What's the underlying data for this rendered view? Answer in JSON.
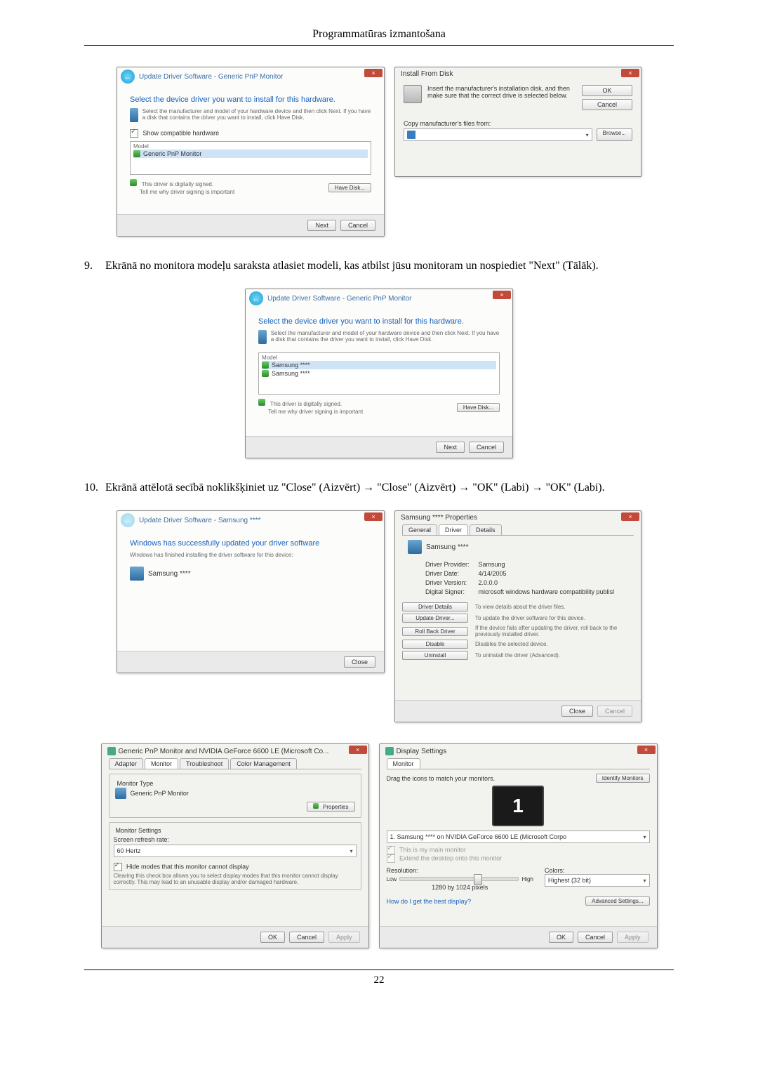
{
  "header": "Programmatūras izmantošana",
  "page_number": "22",
  "step9": {
    "num": "9.",
    "text": "Ekrānā no monitora modeļu saraksta atlasiet modeli, kas atbilst jūsu monitoram un nospiediet \"Next\" (Tālāk)."
  },
  "step10": {
    "num": "10.",
    "text": "Ekrānā attēlotā secībā noklikšķiniet uz \"Close\" (Aizvērt) → \"Close\" (Aizvērt) → \"OK\" (Labi) → \"OK\" (Labi)."
  },
  "wizardA": {
    "breadcrumb": "Update Driver Software - Generic PnP Monitor",
    "heading": "Select the device driver you want to install for this hardware.",
    "subtext": "Select the manufacturer and model of your hardware device and then click Next. If you have a disk that contains the driver you want to install, click Have Disk.",
    "show_compat": "Show compatible hardware",
    "model_label": "Model",
    "model_item": "Generic PnP Monitor",
    "signed": "This driver is digitally signed.",
    "tell_why": "Tell me why driver signing is important",
    "have_disk": "Have Disk...",
    "next": "Next",
    "cancel": "Cancel"
  },
  "installDisk": {
    "title": "Install From Disk",
    "text": "Insert the manufacturer's installation disk, and then make sure that the correct drive is selected below.",
    "ok": "OK",
    "cancel": "Cancel",
    "copy_label": "Copy manufacturer's files from:",
    "browse": "Browse..."
  },
  "wizardB": {
    "breadcrumb": "Update Driver Software - Generic PnP Monitor",
    "heading": "Select the device driver you want to install for this hardware.",
    "subtext": "Select the manufacturer and model of your hardware device and then click Next. If you have a disk that contains the driver you want to install, click Have Disk.",
    "model_label": "Model",
    "model_item1": "Samsung ****",
    "model_item2": "Samsung ****",
    "signed": "This driver is digitally signed.",
    "tell_why": "Tell me why driver signing is important",
    "have_disk": "Have Disk...",
    "next": "Next",
    "cancel": "Cancel"
  },
  "wizardC": {
    "breadcrumb": "Update Driver Software - Samsung ****",
    "heading": "Windows has successfully updated your driver software",
    "subtext": "Windows has finished installing the driver software for this device:",
    "device": "Samsung ****",
    "close": "Close"
  },
  "props": {
    "title": "Samsung **** Properties",
    "tabs": {
      "general": "General",
      "driver": "Driver",
      "details": "Details"
    },
    "device": "Samsung ****",
    "provider_lbl": "Driver Provider:",
    "provider_val": "Samsung",
    "date_lbl": "Driver Date:",
    "date_val": "4/14/2005",
    "version_lbl": "Driver Version:",
    "version_val": "2.0.0.0",
    "signer_lbl": "Digital Signer:",
    "signer_val": "microsoft windows hardware compatibility publisl",
    "btn_details": "Driver Details",
    "btn_details_desc": "To view details about the driver files.",
    "btn_update": "Update Driver...",
    "btn_update_desc": "To update the driver software for this device.",
    "btn_roll": "Roll Back Driver",
    "btn_roll_desc": "If the device fails after updating the driver, roll back to the previously installed driver.",
    "btn_disable": "Disable",
    "btn_disable_desc": "Disables the selected device.",
    "btn_uninstall": "Uninstall",
    "btn_uninstall_desc": "To uninstall the driver (Advanced).",
    "close": "Close",
    "cancel": "Cancel"
  },
  "monDlg": {
    "title": "Generic PnP Monitor and NVIDIA GeForce 6600 LE (Microsoft Co...",
    "tabs": {
      "adapter": "Adapter",
      "monitor": "Monitor",
      "trouble": "Troubleshoot",
      "color": "Color Management"
    },
    "type_label": "Monitor Type",
    "type_value": "Generic PnP Monitor",
    "properties": "Properties",
    "settings_label": "Monitor Settings",
    "refresh_label": "Screen refresh rate:",
    "refresh_value": "60 Hertz",
    "hide_check": "Hide modes that this monitor cannot display",
    "hide_desc": "Clearing this check box allows you to select display modes that this monitor cannot display correctly. This may lead to an unusable display and/or damaged hardware.",
    "ok": "OK",
    "cancel": "Cancel",
    "apply": "Apply"
  },
  "dispDlg": {
    "title": "Display Settings",
    "tab": "Monitor",
    "drag": "Drag the icons to match your monitors.",
    "identify": "Identify Monitors",
    "monitor_dropdown": "1. Samsung **** on NVIDIA GeForce 6600 LE (Microsoft Corpo",
    "main_check": "This is my main monitor",
    "extend_check": "Extend the desktop onto this monitor",
    "res_label": "Resolution:",
    "low": "Low",
    "high": "High",
    "res_value": "1280 by 1024 pixels",
    "colors_label": "Colors:",
    "colors_value": "Highest (32 bit)",
    "best_display": "How do I get the best display?",
    "advanced": "Advanced Settings...",
    "ok": "OK",
    "cancel": "Cancel",
    "apply": "Apply"
  }
}
